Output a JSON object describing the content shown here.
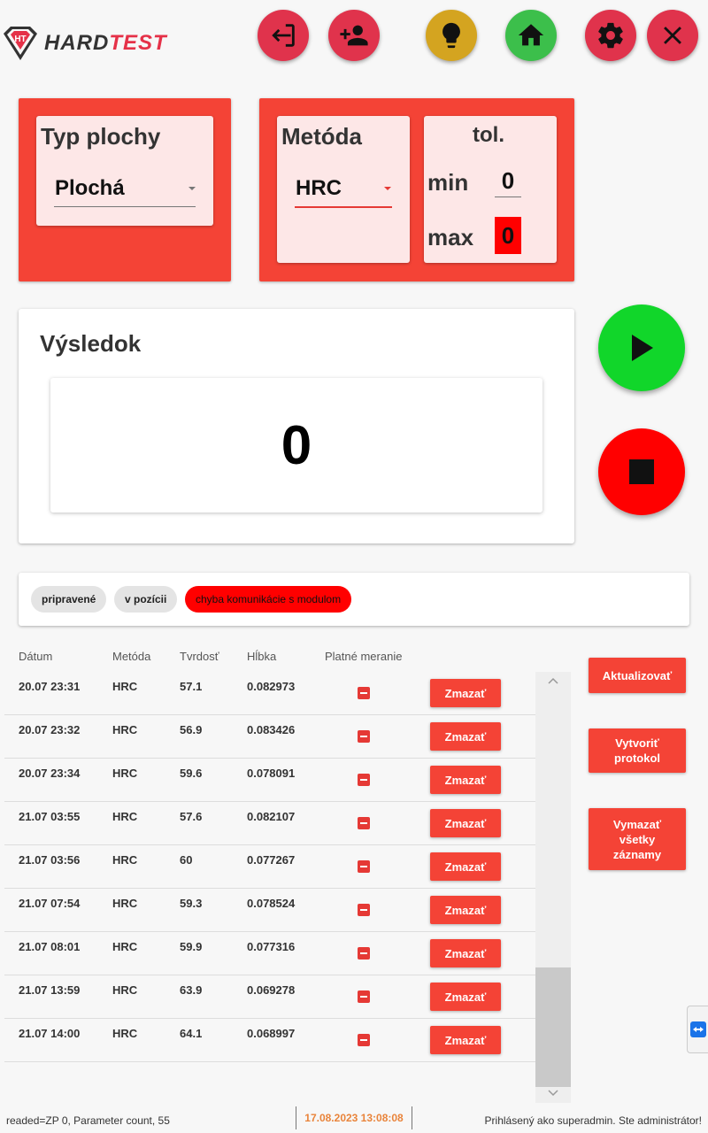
{
  "header": {
    "logo_hard": "HARD",
    "logo_test": "TEST",
    "buttons": [
      {
        "name": "login-icon",
        "color": "#e0334c"
      },
      {
        "name": "add-user-icon",
        "color": "#e0334c"
      },
      {
        "name": "lightbulb-icon",
        "color": "#d4a420"
      },
      {
        "name": "home-icon",
        "color": "#3cbf4b"
      },
      {
        "name": "gear-icon",
        "color": "#e0334c"
      },
      {
        "name": "close-icon",
        "color": "#e0334c"
      }
    ]
  },
  "surface": {
    "title": "Typ plochy",
    "value": "Plochá"
  },
  "method": {
    "title": "Metóda",
    "value": "HRC"
  },
  "tolerance": {
    "title": "tol.",
    "min_label": "min",
    "min_value": "0",
    "max_label": "max",
    "max_value": "0"
  },
  "result": {
    "title": "Výsledok",
    "value": "0"
  },
  "status": {
    "chips": [
      {
        "label": "pripravené",
        "state": "inactive"
      },
      {
        "label": "v pozícii",
        "state": "inactive"
      },
      {
        "label": "chyba komunikácie s modulom",
        "state": "error"
      }
    ]
  },
  "table": {
    "headers": [
      "Dátum",
      "Metóda",
      "Tvrdosť",
      "Hĺbka",
      "Platné meranie"
    ],
    "delete_label": "Zmazať",
    "rows": [
      {
        "date": "20.07  23:31",
        "method": "HRC",
        "hardness": "57.1",
        "depth": "0.082973"
      },
      {
        "date": "20.07  23:32",
        "method": "HRC",
        "hardness": "56.9",
        "depth": "0.083426"
      },
      {
        "date": "20.07  23:34",
        "method": "HRC",
        "hardness": "59.6",
        "depth": "0.078091"
      },
      {
        "date": "21.07  03:55",
        "method": "HRC",
        "hardness": "57.6",
        "depth": "0.082107"
      },
      {
        "date": "21.07  03:56",
        "method": "HRC",
        "hardness": "60",
        "depth": "0.077267"
      },
      {
        "date": "21.07  07:54",
        "method": "HRC",
        "hardness": "59.3",
        "depth": "0.078524"
      },
      {
        "date": "21.07  08:01",
        "method": "HRC",
        "hardness": "59.9",
        "depth": "0.077316"
      },
      {
        "date": "21.07  13:59",
        "method": "HRC",
        "hardness": "63.9",
        "depth": "0.069278"
      },
      {
        "date": "21.07  14:00",
        "method": "HRC",
        "hardness": "64.1",
        "depth": "0.068997"
      }
    ]
  },
  "actions": {
    "refresh": "Aktualizovať",
    "create_protocol": "Vytvoriť protokol",
    "delete_all": "Vymazať všetky záznamy"
  },
  "footer": {
    "left": "readed=ZP 0, Parameter count, 55",
    "datetime": "17.08.2023 13:08:08",
    "right": "Prihlásený ako superadmin. Ste administrátor!"
  },
  "colors": {
    "accent": "#f44336",
    "start": "#11d62a",
    "stop": "#ff0000"
  }
}
